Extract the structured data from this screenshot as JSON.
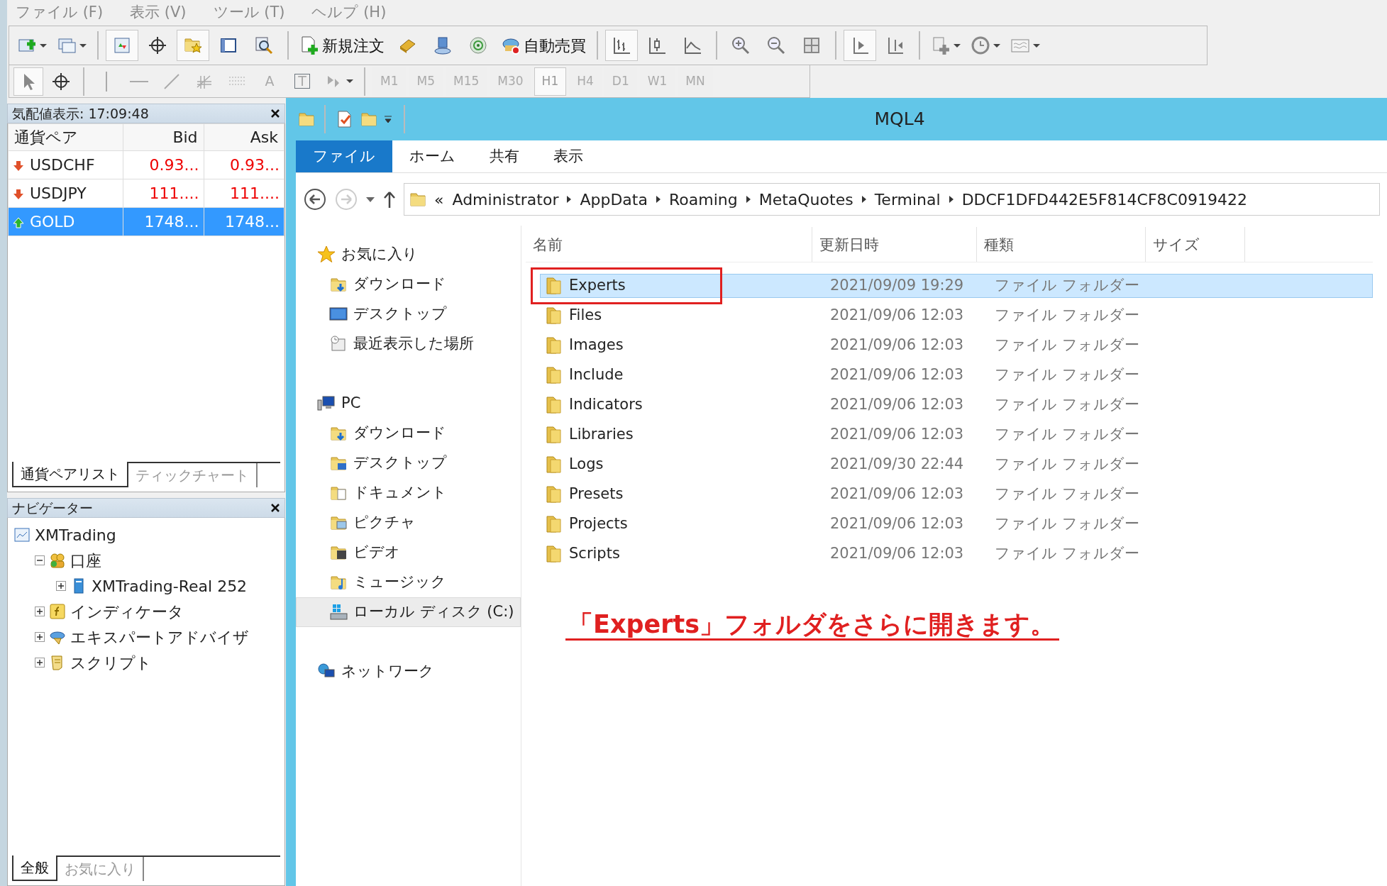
{
  "menu": [
    {
      "label": "ファイル (F)"
    },
    {
      "label": "表示 (V)"
    },
    {
      "label": "ツール (T)"
    },
    {
      "label": "ヘルプ (H)"
    }
  ],
  "toolbar": [
    {
      "kind": "new-chart",
      "pressed": false,
      "dropdown": true
    },
    {
      "kind": "profiles",
      "pressed": false,
      "dropdown": true
    },
    {
      "kind": "sep"
    },
    {
      "kind": "market-watch",
      "pressed": true
    },
    {
      "kind": "crosshair",
      "pressed": false
    },
    {
      "kind": "navigator",
      "pressed": true
    },
    {
      "kind": "terminal",
      "pressed": false
    },
    {
      "kind": "tester",
      "pressed": false
    },
    {
      "kind": "sep"
    },
    {
      "kind": "new-order",
      "pressed": false,
      "label": "新規注文"
    },
    {
      "kind": "editor",
      "pressed": false
    },
    {
      "kind": "signals",
      "pressed": false
    },
    {
      "kind": "radio",
      "pressed": false
    },
    {
      "kind": "auto-trade",
      "pressed": false,
      "label": "自動売買"
    },
    {
      "kind": "sep"
    },
    {
      "kind": "bars",
      "pressed": true
    },
    {
      "kind": "candles",
      "pressed": false
    },
    {
      "kind": "line",
      "pressed": false
    },
    {
      "kind": "sep"
    },
    {
      "kind": "zoom-in",
      "pressed": false
    },
    {
      "kind": "zoom-out",
      "pressed": false
    },
    {
      "kind": "tile",
      "pressed": false
    },
    {
      "kind": "sep"
    },
    {
      "kind": "autoscroll",
      "pressed": true
    },
    {
      "kind": "shift",
      "pressed": false
    },
    {
      "kind": "sep"
    },
    {
      "kind": "indicators",
      "pressed": false,
      "dropdown": true
    },
    {
      "kind": "clock",
      "pressed": false,
      "dropdown": true
    },
    {
      "kind": "template",
      "pressed": false,
      "dropdown": true
    }
  ],
  "drawing_toolbar": [
    {
      "kind": "cursor",
      "pressed": true
    },
    {
      "kind": "crosshair",
      "pressed": false
    },
    {
      "kind": "sep"
    },
    {
      "kind": "vline",
      "pressed": false
    },
    {
      "kind": "hline",
      "pressed": false
    },
    {
      "kind": "trend",
      "pressed": false
    },
    {
      "kind": "fibo",
      "pressed": false
    },
    {
      "kind": "grid",
      "pressed": false
    },
    {
      "kind": "text",
      "pressed": false,
      "label": "A"
    },
    {
      "kind": "boxtext",
      "pressed": false,
      "label": "T"
    },
    {
      "kind": "arrows",
      "pressed": false,
      "dropdown": true
    },
    {
      "kind": "sep"
    }
  ],
  "timeframes": [
    {
      "label": "M1",
      "selected": false
    },
    {
      "label": "M5",
      "selected": false
    },
    {
      "label": "M15",
      "selected": false
    },
    {
      "label": "M30",
      "selected": false
    },
    {
      "label": "H1",
      "selected": true
    },
    {
      "label": "H4",
      "selected": false
    },
    {
      "label": "D1",
      "selected": false
    },
    {
      "label": "W1",
      "selected": false
    },
    {
      "label": "MN",
      "selected": false
    }
  ],
  "market_watch": {
    "title": "気配値表示: 17:09:48",
    "columns": [
      "通貨ペア",
      "Bid",
      "Ask"
    ],
    "rows": [
      {
        "symbol": "USDCHF",
        "bid": "0.93...",
        "ask": "0.93...",
        "rising": false,
        "selected": false
      },
      {
        "symbol": "USDJPY",
        "bid": "111....",
        "ask": "111....",
        "rising": false,
        "selected": false
      },
      {
        "symbol": "GOLD",
        "bid": "1748...",
        "ask": "1748...",
        "rising": true,
        "selected": true
      }
    ],
    "tabs": [
      {
        "label": "通貨ペアリスト",
        "selected": true
      },
      {
        "label": "ティックチャート",
        "selected": false
      }
    ]
  },
  "navigator": {
    "title": "ナビゲーター",
    "tree": [
      {
        "label": "XMTrading",
        "kind": "terminal",
        "children": [
          {
            "label": "口座",
            "kind": "accounts",
            "expanded": true,
            "children": [
              {
                "label": "XMTrading-Real 252",
                "kind": "server",
                "expanded": false
              }
            ]
          },
          {
            "label": "インディケータ",
            "kind": "indicator",
            "expanded": false
          },
          {
            "label": "エキスパートアドバイザ",
            "kind": "expert",
            "expanded": false
          },
          {
            "label": "スクリプト",
            "kind": "script",
            "expanded": false
          }
        ]
      }
    ],
    "tabs": [
      {
        "label": "全般",
        "selected": true
      },
      {
        "label": "お気に入り",
        "selected": false
      }
    ]
  },
  "explorer": {
    "title": "MQL4",
    "ribbon_tabs": [
      {
        "label": "ファイル",
        "selected": true
      },
      {
        "label": "ホーム",
        "selected": false
      },
      {
        "label": "共有",
        "selected": false
      },
      {
        "label": "表示",
        "selected": false
      }
    ],
    "path_prefix": "«",
    "path": [
      "Administrator",
      "AppData",
      "Roaming",
      "MetaQuotes",
      "Terminal",
      "DDCF1DFD442E5F814CF8C0919422"
    ],
    "nav": [
      {
        "label": "お気に入り",
        "kind": "star",
        "items": [
          {
            "label": "ダウンロード",
            "kind": "download",
            "selected": false
          },
          {
            "label": "デスクトップ",
            "kind": "desktop",
            "selected": false
          },
          {
            "label": "最近表示した場所",
            "kind": "recent",
            "selected": false
          }
        ]
      },
      {
        "label": "PC",
        "kind": "pc",
        "items": [
          {
            "label": "ダウンロード",
            "kind": "download",
            "selected": false
          },
          {
            "label": "デスクトップ",
            "kind": "desktop-folder",
            "selected": false
          },
          {
            "label": "ドキュメント",
            "kind": "documents",
            "selected": false
          },
          {
            "label": "ピクチャ",
            "kind": "pictures",
            "selected": false
          },
          {
            "label": "ビデオ",
            "kind": "videos",
            "selected": false
          },
          {
            "label": "ミュージック",
            "kind": "music",
            "selected": false
          },
          {
            "label": "ローカル ディスク (C:)",
            "kind": "disk",
            "selected": true
          }
        ]
      },
      {
        "label": "ネットワーク",
        "kind": "network"
      }
    ],
    "columns": [
      "名前",
      "更新日時",
      "種類",
      "サイズ"
    ],
    "files": [
      {
        "name": "Experts",
        "modified": "2021/09/09 19:29",
        "type": "ファイル フォルダー",
        "selected": true,
        "highlighted": true
      },
      {
        "name": "Files",
        "modified": "2021/09/06 12:03",
        "type": "ファイル フォルダー",
        "selected": false,
        "highlighted": false
      },
      {
        "name": "Images",
        "modified": "2021/09/06 12:03",
        "type": "ファイル フォルダー",
        "selected": false,
        "highlighted": false
      },
      {
        "name": "Include",
        "modified": "2021/09/06 12:03",
        "type": "ファイル フォルダー",
        "selected": false,
        "highlighted": false
      },
      {
        "name": "Indicators",
        "modified": "2021/09/06 12:03",
        "type": "ファイル フォルダー",
        "selected": false,
        "highlighted": false
      },
      {
        "name": "Libraries",
        "modified": "2021/09/06 12:03",
        "type": "ファイル フォルダー",
        "selected": false,
        "highlighted": false
      },
      {
        "name": "Logs",
        "modified": "2021/09/30 22:44",
        "type": "ファイル フォルダー",
        "selected": false,
        "highlighted": false
      },
      {
        "name": "Presets",
        "modified": "2021/09/06 12:03",
        "type": "ファイル フォルダー",
        "selected": false,
        "highlighted": false
      },
      {
        "name": "Projects",
        "modified": "2021/09/06 12:03",
        "type": "ファイル フォルダー",
        "selected": false,
        "highlighted": false
      },
      {
        "name": "Scripts",
        "modified": "2021/09/06 12:03",
        "type": "ファイル フォルダー",
        "selected": false,
        "highlighted": false
      }
    ],
    "annotation": "「Experts」フォルダをさらに開きます。"
  }
}
